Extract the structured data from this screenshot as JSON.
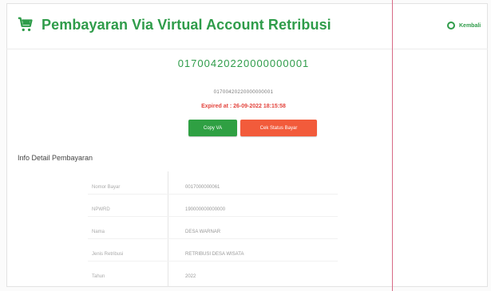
{
  "header": {
    "title": "Pembayaran Via Virtual Account Retribusi",
    "back_label": "Kembali",
    "icon": "shopping-cart-icon",
    "accent_color": "#2f9c4a"
  },
  "virtual_account": {
    "number": "01700420220000000001",
    "number_small": "01700420220000000001",
    "expired_text": "Expired at : 26-09-2022 18:15:58",
    "copy_button": "Copy VA",
    "check_status_button": "Cek Status Bayar"
  },
  "detail": {
    "section_title": "Info Detail Pembayaran",
    "rows": [
      {
        "label": "Nomor Bayar",
        "value": "0017000000061"
      },
      {
        "label": "NPWRD",
        "value": "190000000000000"
      },
      {
        "label": "Nama",
        "value": "DESA WARNAR"
      },
      {
        "label": "Jenis Retribusi",
        "value": "RETRIBUSI DESA WISATA"
      },
      {
        "label": "Tahun",
        "value": "2022"
      }
    ]
  }
}
